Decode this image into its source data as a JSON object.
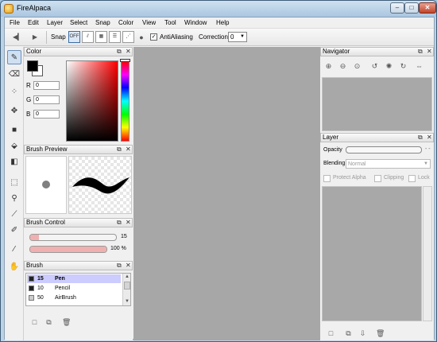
{
  "window": {
    "title": "FireAlpaca",
    "minimize_glyph": "–",
    "maximize_glyph": "□",
    "close_glyph": "✕"
  },
  "menu": [
    "File",
    "Edit",
    "Layer",
    "Select",
    "Snap",
    "Color",
    "View",
    "Tool",
    "Window",
    "Help"
  ],
  "toolbar": {
    "snap_label": "Snap",
    "snap_off_label": "OFF",
    "antialiasing_label": "AntiAliasing",
    "antialiasing_checked": true,
    "correction_label": "Correction",
    "correction_value": "0"
  },
  "color_panel": {
    "title": "Color",
    "r_label": "R",
    "r_value": "0",
    "g_label": "G",
    "g_value": "0",
    "b_label": "B",
    "b_value": "0",
    "foreground": "#000000",
    "background": "#ffffff",
    "hue": "#ff0000"
  },
  "brush_preview_panel": {
    "title": "Brush Preview"
  },
  "brush_control_panel": {
    "title": "Brush Control",
    "size_value": "15",
    "size_fraction": 0.1,
    "opacity_value": "100 %",
    "opacity_fraction": 1.0
  },
  "brush_panel": {
    "title": "Brush",
    "items": [
      {
        "size": "15",
        "name": "Pen"
      },
      {
        "size": "10",
        "name": "Pencil"
      },
      {
        "size": "50",
        "name": "AirBrush"
      }
    ]
  },
  "navigator_panel": {
    "title": "Navigator"
  },
  "layer_panel": {
    "title": "Layer",
    "opacity_label": "Opacity",
    "blending_label": "Blending",
    "blending_value": "Normal",
    "protect_alpha_label": "Protect Alpha",
    "clipping_label": "Clipping",
    "lock_label": "Lock"
  }
}
